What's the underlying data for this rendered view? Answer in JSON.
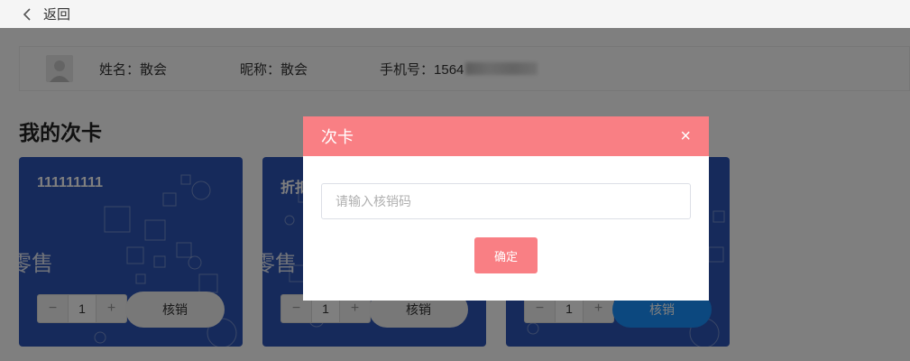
{
  "topbar": {
    "back_label": "返回"
  },
  "member": {
    "name_text": "姓名：散会",
    "nickname_text": "昵称：散会",
    "phone_text": "手机号：1564"
  },
  "section_title": "我的次卡",
  "cards": [
    {
      "name": "111111111",
      "type": "零售",
      "quantity": "1",
      "redeem_label": "核销"
    },
    {
      "name": "折扣",
      "type": "零售",
      "quantity": "1",
      "redeem_label": "核销"
    },
    {
      "name": "",
      "type": "",
      "quantity": "1",
      "redeem_label": "核销"
    }
  ],
  "stepper": {
    "minus": "−",
    "plus": "+"
  },
  "modal": {
    "title": "次卡",
    "close": "×",
    "input_placeholder": "请输入核销码",
    "input_value": "",
    "confirm_label": "确定"
  },
  "colors": {
    "accent": "#f97f84",
    "card_bg": "#2d55b6",
    "primary_blue": "#1890ff"
  }
}
